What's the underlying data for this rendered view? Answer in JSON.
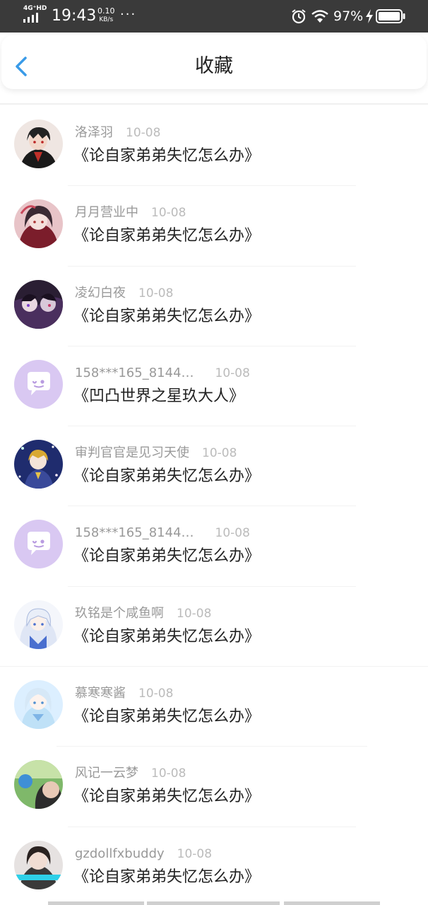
{
  "status_bar": {
    "network": "4G⁺HD",
    "time": "19:43",
    "speed_value": "0.10",
    "speed_unit": "KB/s",
    "more": "···",
    "battery_percent": "97%",
    "icons": [
      "signal-icon",
      "alarm-icon",
      "wifi-icon",
      "charging-icon",
      "battery-icon"
    ]
  },
  "header": {
    "title": "收藏",
    "back_icon": "chevron-left-icon",
    "accent_color": "#3a9be8"
  },
  "favorites": [
    {
      "author": "洛泽羽",
      "date": "10-08",
      "title": "《论自家弟弟失忆怎么办》",
      "avatar": "anime-boy-red-black"
    },
    {
      "author": "月月营业中",
      "date": "10-08",
      "title": "《论自家弟弟失忆怎么办》",
      "avatar": "anime-girl-red"
    },
    {
      "author": "凌幻白夜",
      "date": "10-08",
      "title": "《论自家弟弟失忆怎么办》",
      "avatar": "anime-dark-purple"
    },
    {
      "author": "158***165_8144…",
      "date": "10-08",
      "title": "《凹凸世界之星玖大人》",
      "avatar": "default-chat-bubble"
    },
    {
      "author": "审判官官是见习天使",
      "date": "10-08",
      "title": "《论自家弟弟失忆怎么办》",
      "avatar": "anime-blue-stars"
    },
    {
      "author": "158***165_8144…",
      "date": "10-08",
      "title": "《论自家弟弟失忆怎么办》",
      "avatar": "default-chat-bubble"
    },
    {
      "author": "玖铭是个咸鱼啊",
      "date": "10-08",
      "title": "《论自家弟弟失忆怎么办》",
      "avatar": "anime-white-hair"
    },
    {
      "author": "慕寒寒酱",
      "date": "10-08",
      "title": "《论自家弟弟失忆怎么办》",
      "avatar": "anime-light-blue"
    },
    {
      "author": "风记一云梦",
      "date": "10-08",
      "title": "《论自家弟弟失忆怎么办》",
      "avatar": "photo-green"
    },
    {
      "author": "gzdollfxbuddy",
      "date": "10-08",
      "title": "《论自家弟弟失忆怎么办》",
      "avatar": "photo-portrait"
    }
  ]
}
